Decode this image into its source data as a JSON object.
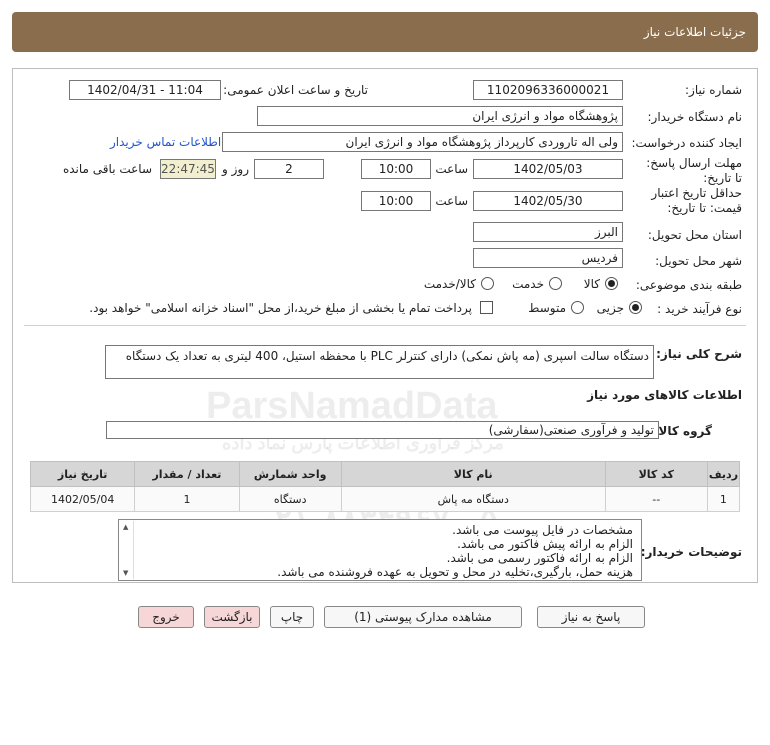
{
  "header": {
    "title": "جزئیات اطلاعات نیاز"
  },
  "need_number": {
    "label": "شماره نیاز:",
    "value": "1102096336000021"
  },
  "announce": {
    "label": "تاریخ و ساعت اعلان عمومی:",
    "value": "1402/04/31 - 11:04"
  },
  "buyer": {
    "label": "نام دستگاه خریدار:",
    "value": "پژوهشگاه مواد و انرژی ایران"
  },
  "creator": {
    "label": "ایجاد کننده درخواست:",
    "value": "ولی اله تاروردی کارپرداز پژوهشگاه مواد و انرژی ایران",
    "contact_link": "اطلاعات تماس خریدار"
  },
  "deadline": {
    "label": "مهلت ارسال پاسخ: تا تاریخ:",
    "date": "1402/05/03",
    "time_label": "ساعت",
    "time": "10:00",
    "days": "2",
    "days_label": "روز و",
    "remaining": "22:47:45",
    "remaining_label": "ساعت باقی مانده"
  },
  "validity": {
    "label_line1": "حداقل تاریخ اعتبار",
    "label_line2": "قیمت: تا تاریخ:",
    "date": "1402/05/30",
    "time_label": "ساعت",
    "time": "10:00"
  },
  "province": {
    "label": "استان محل تحویل:",
    "value": "البرز"
  },
  "city": {
    "label": "شهر محل تحویل:",
    "value": "فردیس"
  },
  "category": {
    "label": "طبقه بندی موضوعی:",
    "options": [
      "کالا",
      "خدمت",
      "کالا/خدمت"
    ],
    "selected": "کالا"
  },
  "purchase_type": {
    "label": "نوع فرآیند خرید :",
    "options": [
      "جزیی",
      "متوسط"
    ],
    "selected": "جزیی",
    "checkbox_text": "پرداخت تمام یا بخشی از مبلغ خرید،از محل \"اسناد خزانه اسلامی\" خواهد بود."
  },
  "description": {
    "label": "شرح کلی نیاز:",
    "value": "دستگاه سالت اسپری (مه پاش نمکی) دارای کنترلر PLC با محفظه استیل، 400 لیتری به تعداد یک دستگاه"
  },
  "goods_info": {
    "title": "اطلاعات کالاهای مورد نیاز"
  },
  "goods_group": {
    "label": "گروه کالا:",
    "value": "تولید و فرآوری صنعتی(سفارشی)"
  },
  "table": {
    "headers": [
      "ردیف",
      "کد کالا",
      "نام کالا",
      "واحد شمارش",
      "تعداد / مقدار",
      "تاریخ نیاز"
    ],
    "rows": [
      [
        "1",
        "--",
        "دستگاه مه پاش",
        "دستگاه",
        "1",
        "1402/05/04"
      ]
    ]
  },
  "buyer_notes": {
    "label": "توضیحات خریدار:",
    "lines": [
      "مشخصات در فایل پیوست می باشد.",
      "الزام به ارائه پیش فاکتور می باشد.",
      "الزام به ارائه فاکتور رسمی می باشد.",
      "هزینه حمل، بارگیری،تخلیه در محل و تحویل به  عهده فروشنده می باشد."
    ]
  },
  "buttons": {
    "reply": "پاسخ به نیاز",
    "attachments": "مشاهده مدارک پیوستی (1)",
    "print": "چاپ",
    "back": "بازگشت",
    "exit": "خروج"
  },
  "watermark": {
    "brand": "ParsNamadData",
    "line1": "مرکز فراوری اطلاعات پارس نماد داده",
    "line2": "پایگاه اطلاع رسانی مناقصه و مزایده",
    "phone": "۰۲۱-۸۸۳۴۹۶۷۰-۵"
  },
  "colors": {
    "header": "#8a6d4c",
    "link": "#2255cc",
    "remaining_bg": "#f2efcf",
    "exit_bg": "#f6d6d6"
  }
}
